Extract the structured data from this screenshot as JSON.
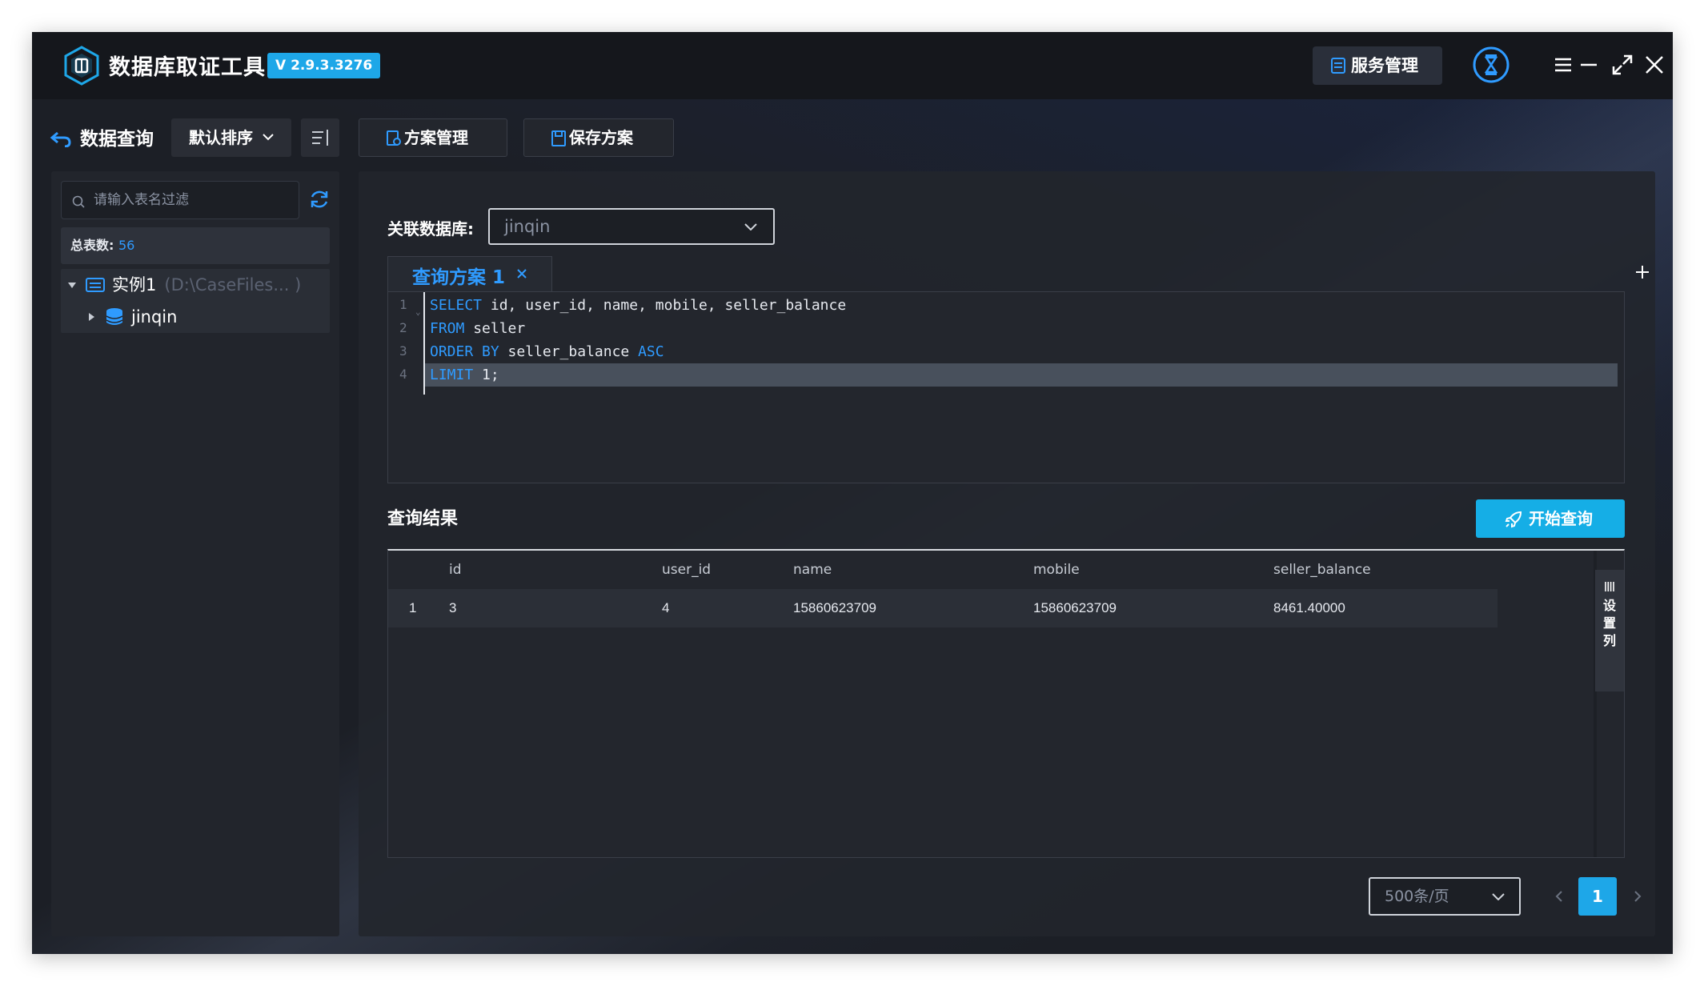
{
  "app": {
    "title": "数据库取证工具",
    "version": "V 2.9.3.3276",
    "service_label": "服务管理"
  },
  "toolbar": {
    "back_label": "数据查询",
    "sort_label": "默认排序",
    "plan_manage_label": "方案管理",
    "save_plan_label": "保存方案"
  },
  "sidebar": {
    "filter_placeholder": "请输入表名过滤",
    "count_label": "总表数:",
    "count_value": "56",
    "tree": [
      {
        "label": "实例1",
        "path": "(D:\\CaseFiles... )",
        "expanded": true
      },
      {
        "label": "jinqin",
        "expanded": false
      }
    ]
  },
  "main": {
    "db_label": "关联数据库:",
    "db_value": "jinqin",
    "tab_label": "查询方案 1",
    "editor": {
      "line_numbers": [
        "1",
        "2",
        "3",
        "4"
      ],
      "lines": [
        {
          "kw": "SELECT",
          "rest": " id, user_id, name, mobile, seller_balance"
        },
        {
          "kw": "FROM",
          "rest": " seller"
        },
        {
          "kw": "ORDER BY",
          "rest": " seller_balance ",
          "kw2": "ASC"
        },
        {
          "kw": "LIMIT",
          "rest": " 1;"
        }
      ]
    },
    "results_title": "查询结果",
    "run_label": "开始查询",
    "grid": {
      "columns": [
        "id",
        "user_id",
        "name",
        "mobile",
        "seller_balance"
      ],
      "rows": [
        {
          "index": "1",
          "cells": [
            "3",
            "4",
            "15860623709",
            "15860623709",
            "8461.40000"
          ]
        }
      ],
      "settings_label": [
        "设",
        "置",
        "列"
      ]
    },
    "pagination": {
      "page_size": "500条/页",
      "current_page": "1"
    }
  },
  "colors": {
    "accent": "#2f9bff",
    "primary_button": "#15aee6",
    "window_bg": "#1c1f26",
    "titlebar_bg": "#15171c"
  }
}
